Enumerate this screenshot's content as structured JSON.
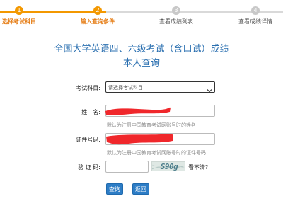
{
  "stepper": {
    "steps": [
      {
        "num": "1",
        "label": "选择考试科目"
      },
      {
        "num": "2",
        "label": "输入查询条件"
      },
      {
        "num": "3",
        "label": "查看成绩列表"
      },
      {
        "num": "4",
        "label": "查看成绩详情"
      }
    ],
    "active_color": "#f39800",
    "inactive_color": "#c8c8c8"
  },
  "page": {
    "title_line1": "全国大学英语四、六级考试（含口试）成绩",
    "title_line2": "本人查询",
    "title_color": "#2a6fb0"
  },
  "form": {
    "exam_label": "考试科目:",
    "exam_select_value": "请选择考试科目",
    "name_label": "姓　名:",
    "name_hint": "默认为注册中国教育考试网账号时的姓名",
    "id_label": "证件号码:",
    "id_hint": "默认为注册中国教育考试网账号时的证件号码",
    "captcha_label": "验 证 码:",
    "captcha_text": "S90g",
    "captcha_refresh": "看不清?"
  },
  "buttons": {
    "query": "查询",
    "back": "返回",
    "color": "#2d7dc6"
  }
}
